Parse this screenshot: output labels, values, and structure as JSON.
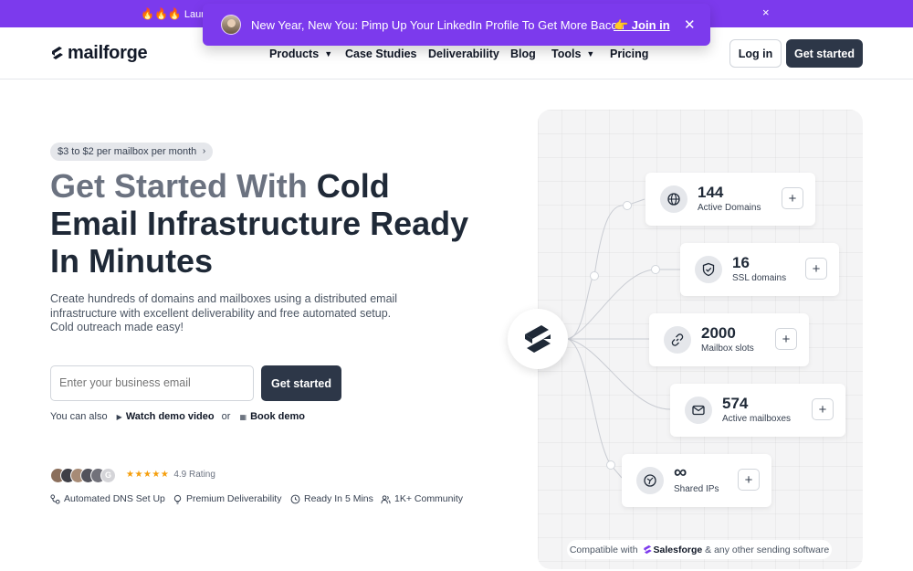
{
  "banner": {
    "lead_text": "Laun",
    "close": "×"
  },
  "toast": {
    "message": "New Year, New You: Pimp Up Your LinkedIn Profile To Get More Bacon",
    "cta": "👉 Join in",
    "close": "✕"
  },
  "nav": {
    "brand": "mailforge",
    "items": [
      {
        "label": "Products",
        "has_dropdown": true
      },
      {
        "label": "Case Studies",
        "has_dropdown": false
      },
      {
        "label": "Deliverability",
        "has_dropdown": false
      },
      {
        "label": "Blog",
        "has_dropdown": false
      },
      {
        "label": "Tools",
        "has_dropdown": true
      },
      {
        "label": "Pricing",
        "has_dropdown": false
      }
    ],
    "login": "Log in",
    "get_started": "Get started"
  },
  "hero": {
    "pill": "$3 to $2 per mailbox per month",
    "title_muted": "Get Started With",
    "title_rest": "Cold Email Infrastructure Ready In Minutes",
    "description": "Create hundreds of domains and mailboxes using a distributed email infrastructure with excellent deliverability and free automated setup. Cold outreach made easy!",
    "email_placeholder": "Enter your business email",
    "cta": "Get started",
    "also_prefix": "You can also",
    "watch_demo": "Watch demo video",
    "or": "or",
    "book_demo": "Book demo",
    "rating": "4.9 Rating",
    "stars": "★★★★★",
    "features": [
      "Automated DNS Set Up",
      "Premium Deliverability",
      "Ready In 5 Mins",
      "1K+ Community"
    ]
  },
  "panel": {
    "stats": [
      {
        "value": "144",
        "label": "Active Domains",
        "icon": "globe-icon"
      },
      {
        "value": "16",
        "label": "SSL domains",
        "icon": "shield-check-icon"
      },
      {
        "value": "2000",
        "label": "Mailbox slots",
        "icon": "link-icon"
      },
      {
        "value": "574",
        "label": "Active mailboxes",
        "icon": "mail-icon"
      },
      {
        "value": "∞",
        "label": "Shared IPs",
        "icon": "network-icon"
      }
    ],
    "compat_prefix": "Compatible with",
    "compat_brand": "Salesforge",
    "compat_suffix": "& any other sending software"
  },
  "colors": {
    "accent": "#7c3aed",
    "dark_button": "#2d3748",
    "star": "#f59e0b"
  }
}
